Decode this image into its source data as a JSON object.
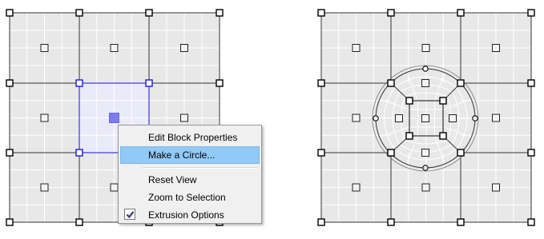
{
  "context_menu": {
    "items": [
      {
        "label": "Edit Block Properties",
        "highlighted": false
      },
      {
        "label": "Make a Circle...",
        "highlighted": true
      },
      {
        "label": "Reset View",
        "highlighted": false
      },
      {
        "label": "Zoom to Selection",
        "highlighted": false
      },
      {
        "label": "Extrusion Options",
        "highlighted": false,
        "checked": true
      }
    ]
  },
  "colors": {
    "canvas_bg": "#e8e8e8",
    "mesh_line": "#ffffff",
    "block_edge": "#333333",
    "vertex_fill": "#ffffff",
    "vertex_stroke": "#000000",
    "selection_fill": "#eaeaf9",
    "selection_stroke": "#5050e0",
    "selection_center": "#7c7cf0",
    "menu_bg": "#f0f0f0",
    "menu_highlight": "#91c9f7"
  },
  "icons": {
    "block_marker": "small-square-icon",
    "vertex": "vertex-handle-icon",
    "arc_handle": "arc-handle-icon",
    "check": "checkmark-icon"
  }
}
